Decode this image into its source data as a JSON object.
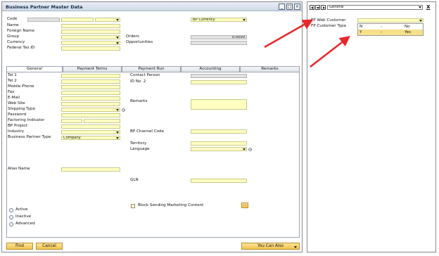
{
  "window": {
    "title": "Business Partner Master Data"
  },
  "header": {
    "code": "Code",
    "name": "Name",
    "foreign_name": "Foreign Name",
    "group": "Group",
    "currency": "Currency",
    "federal_tax_id": "Federal Tax ID",
    "bp_currency": "BP Currency",
    "orders": "Orders",
    "orders_value": "0.0000",
    "opportunities": "Opportunities"
  },
  "tabs": [
    "General",
    "Payment Terms",
    "Payment Run",
    "Accounting",
    "Remarks"
  ],
  "general": {
    "tel1": "Tel 1",
    "tel2": "Tel 2",
    "mobile": "Mobile Phone",
    "fax": "Fax",
    "email": "E-Mail",
    "website": "Web Site",
    "shipping_type": "Shipping Type",
    "password": "Password",
    "factoring": "Factoring Indicator",
    "bp_project": "BP Project",
    "industry": "Industry",
    "bp_type": "Business Partner Type",
    "bp_type_value": "Company",
    "alias_name": "Alias Name",
    "contact_person": "Contact Person",
    "id_no2": "ID No. 2",
    "remarks": "Remarks",
    "bp_channel_code": "BP Channel Code",
    "territory": "Territory",
    "language": "Language",
    "gln": "GLN",
    "block_marketing": "Block Sending Marketing Content",
    "more": "...",
    "status": [
      "Active",
      "Inactive",
      "Advanced"
    ]
  },
  "footer": {
    "find": "Find",
    "cancel": "Cancel",
    "you_can_also": "You Can Also"
  },
  "side_panel": {
    "selector": "General",
    "fp_web_customer": "FP Web Customer",
    "fp_customer_type": "FP Customer Type",
    "options": [
      {
        "code": "N",
        "dash": "-",
        "label": "No"
      },
      {
        "code": "Y",
        "dash": "-",
        "label": "Yes"
      }
    ],
    "close": "X"
  },
  "colors": {
    "field": "#ffffc2",
    "highlight": "#f6e08a",
    "arrow": "#e8262a"
  }
}
